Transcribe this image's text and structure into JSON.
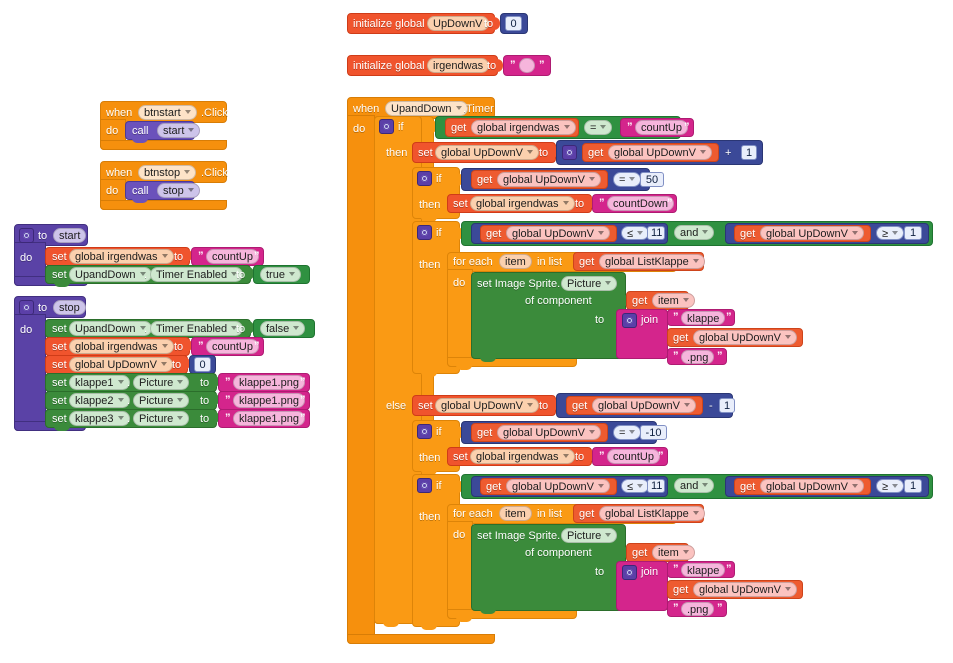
{
  "app": {
    "name": "MIT App Inventor Blocks Editor",
    "canvas_background": "#ffffff"
  },
  "colors": {
    "control": "#f6900d",
    "variables": "#f0542d",
    "math": "#3b4998",
    "logic": "#2f9141",
    "text": "#d4258c",
    "procedures": "#5a42a6",
    "component_set": "#3b8b3b"
  },
  "globals": [
    {
      "keyword": "initialize global",
      "name": "UpDownV",
      "to": "to",
      "value": "0",
      "value_type": "number"
    },
    {
      "keyword": "initialize global",
      "name": "irgendwas",
      "to": "to",
      "value": "",
      "value_type": "text"
    }
  ],
  "event_handlers": [
    {
      "when": "when",
      "component": "btnstart",
      "event": ".Click",
      "do": "do",
      "call": "call",
      "procedure": "start"
    },
    {
      "when": "when",
      "component": "btnstop",
      "event": ".Click",
      "do": "do",
      "call": "call",
      "procedure": "stop"
    }
  ],
  "procedures": [
    {
      "to": "to",
      "name": "start",
      "do": "do",
      "statements": [
        {
          "set": "set",
          "target": "global irgendwas",
          "to": "to",
          "value": "countUp",
          "value_type": "text"
        },
        {
          "set": "set",
          "component": "UpandDown",
          "dot": ".",
          "property": "Timer Enabled",
          "to": "to",
          "value": "true",
          "value_type": "logic"
        }
      ]
    },
    {
      "to": "to",
      "name": "stop",
      "do": "do",
      "statements": [
        {
          "set": "set",
          "component": "UpandDown",
          "dot": ".",
          "property": "Timer Enabled",
          "to": "to",
          "value": "false",
          "value_type": "logic"
        },
        {
          "set": "set",
          "target": "global irgendwas",
          "to": "to",
          "value": "countUp",
          "value_type": "text"
        },
        {
          "set": "set",
          "target": "global UpDownV",
          "to": "to",
          "value": "0",
          "value_type": "number"
        },
        {
          "set": "set",
          "component": "klappe1",
          "dot": ".",
          "property": "Picture",
          "to": "to",
          "value": "klappe1.png",
          "value_type": "text"
        },
        {
          "set": "set",
          "component": "klappe2",
          "dot": ".",
          "property": "Picture",
          "to": "to",
          "value": "klappe1.png",
          "value_type": "text"
        },
        {
          "set": "set",
          "component": "klappe3",
          "dot": ".",
          "property": "Picture",
          "to": "to",
          "value": "klappe1.png",
          "value_type": "text"
        }
      ]
    }
  ],
  "timer_block": {
    "when": "when",
    "component": "UpandDown",
    "event": ".Timer",
    "do": "do",
    "if_label": "if",
    "then_label": "then",
    "else_label": "else",
    "condition": {
      "get": "get",
      "variable": "global irgendwas",
      "operator": "=",
      "compare_to": "countUp"
    },
    "then_branch": {
      "increment": {
        "set": "set",
        "target": "global UpDownV",
        "to": "to",
        "get": "get",
        "get_var": "global UpDownV",
        "operator": "+",
        "operand": "1"
      },
      "if_limit": {
        "if_label": "if",
        "then_label": "then",
        "get": "get",
        "get_var": "global UpDownV",
        "operator": "=",
        "operand": "50",
        "set": "set",
        "set_target": "global irgendwas",
        "to": "to",
        "set_value": "countDown"
      },
      "if_range": {
        "if_label": "if",
        "then_label": "then",
        "left_get": "get",
        "left_var": "global UpDownV",
        "left_op": "≤",
        "left_val": "11",
        "and": "and",
        "right_get": "get",
        "right_var": "global UpDownV",
        "right_op": "≥",
        "right_val": "1",
        "foreach": {
          "for_each": "for each",
          "item": "item",
          "in_list": "in list",
          "get": "get",
          "list_var": "global ListKlappe",
          "do": "do",
          "set_sprite": "set Image Sprite.",
          "property": "Picture",
          "of_component": "of component",
          "component_get": "get",
          "component_var": "item",
          "to": "to",
          "join": "join",
          "join_part1": "klappe",
          "join_part2_get": "get",
          "join_part2_var": "global UpDownV",
          "join_part3": ".png"
        }
      }
    },
    "else_branch": {
      "decrement": {
        "set": "set",
        "target": "global UpDownV",
        "to": "to",
        "get": "get",
        "get_var": "global UpDownV",
        "operator": "-",
        "operand": "1"
      },
      "if_limit": {
        "if_label": "if",
        "then_label": "then",
        "get": "get",
        "get_var": "global UpDownV",
        "operator": "=",
        "operand": "-10",
        "set": "set",
        "set_target": "global irgendwas",
        "to": "to",
        "set_value": "countUp"
      },
      "if_range": {
        "if_label": "if",
        "then_label": "then",
        "left_get": "get",
        "left_var": "global UpDownV",
        "left_op": "≤",
        "left_val": "11",
        "and": "and",
        "right_get": "get",
        "right_var": "global UpDownV",
        "right_op": "≥",
        "right_val": "1",
        "foreach": {
          "for_each": "for each",
          "item": "item",
          "in_list": "in list",
          "get": "get",
          "list_var": "global ListKlappe",
          "do": "do",
          "set_sprite": "set Image Sprite.",
          "property": "Picture",
          "of_component": "of component",
          "component_get": "get",
          "component_var": "item",
          "to": "to",
          "join": "join",
          "join_part1": "klappe",
          "join_part2_get": "get",
          "join_part2_var": "global UpDownV",
          "join_part3": ".png"
        }
      }
    }
  }
}
